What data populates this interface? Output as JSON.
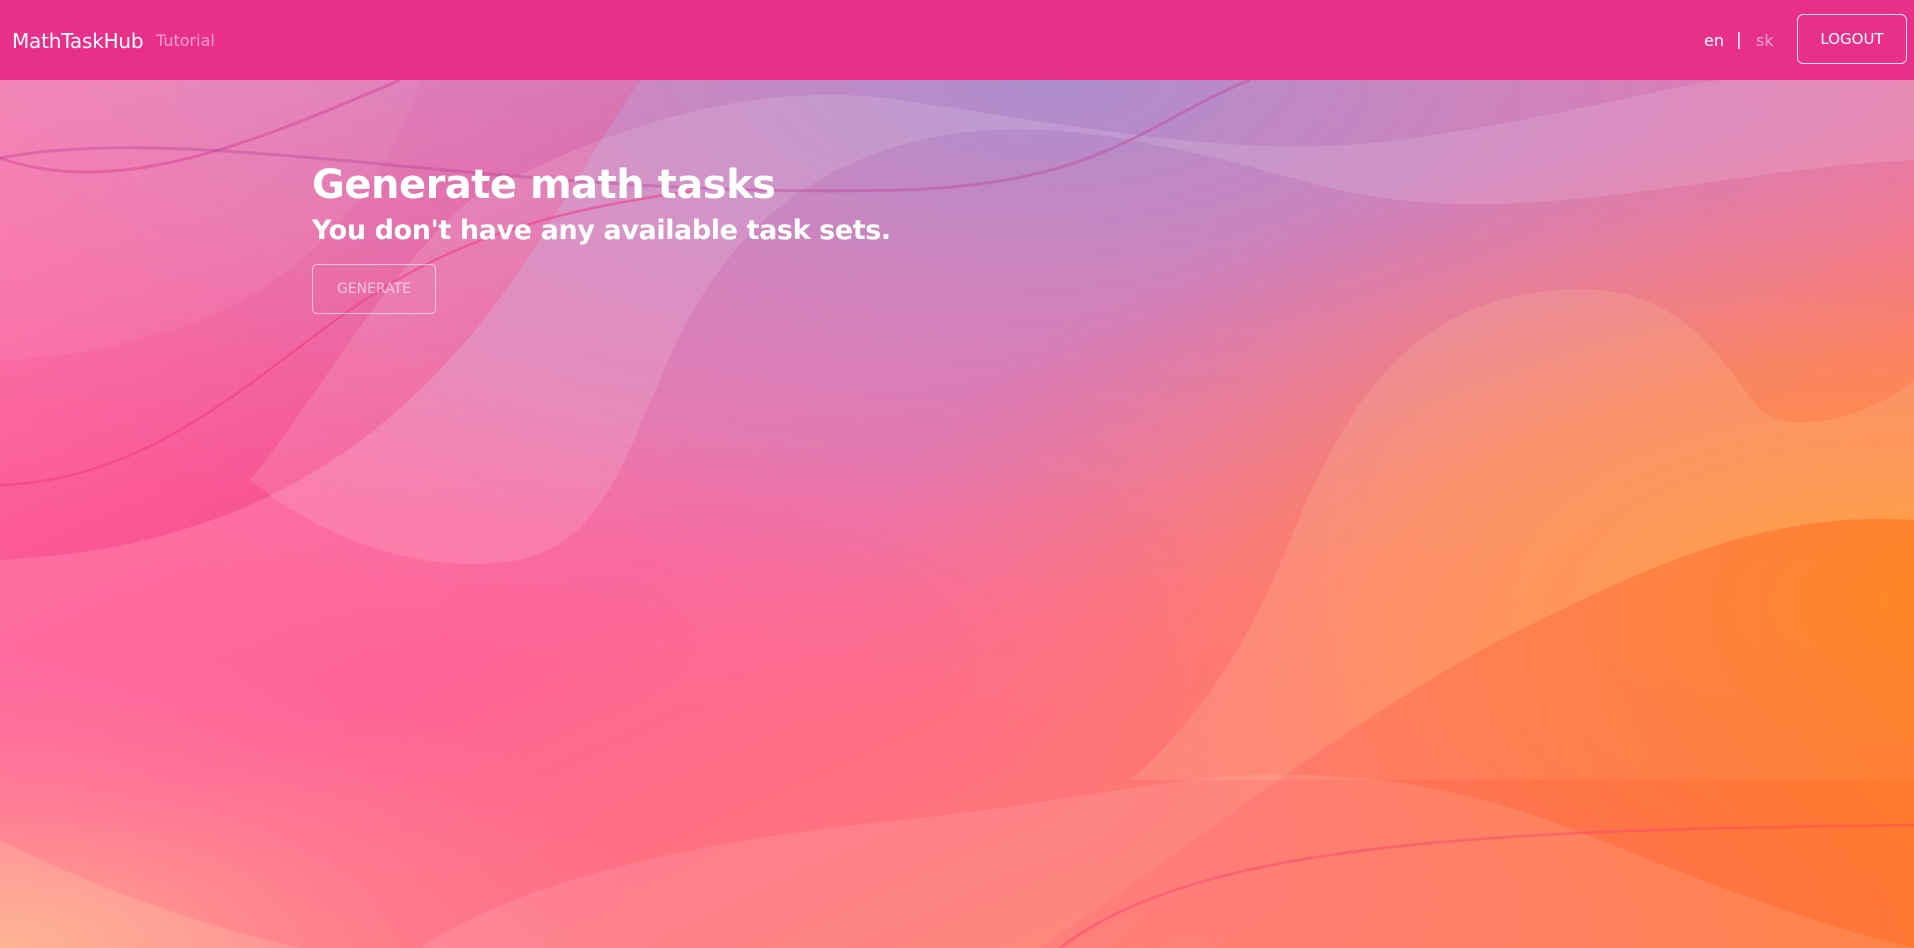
{
  "navbar": {
    "brand": "MathTaskHub",
    "links": [
      {
        "label": "Tutorial"
      }
    ],
    "languages": {
      "en": "en",
      "separator": "|",
      "sk": "sk",
      "active": "en"
    },
    "logout_label": "LOGOUT",
    "color": "#e8308a"
  },
  "main": {
    "title": "Generate math tasks",
    "subtitle": "You don't have any available task sets.",
    "generate_label": "GENERATE",
    "generate_disabled": true
  },
  "background": {
    "colors": {
      "pink": "#ff6496",
      "violet": "#a88ecb",
      "orange": "#ff8a3a",
      "amber": "#ffa21e"
    }
  }
}
